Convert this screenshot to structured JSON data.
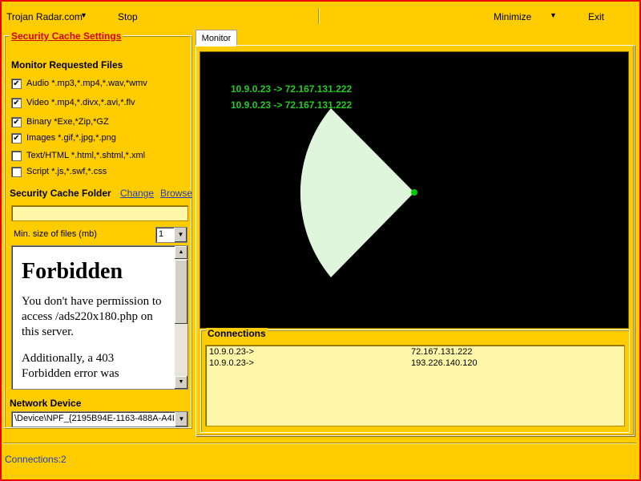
{
  "topbar": {
    "app_title": "Trojan Radar.com",
    "stop_label": "Stop",
    "minimize_label": "Minimize",
    "exit_label": "Exit"
  },
  "settings": {
    "title": "Security Cache Settings",
    "monitor_heading": "Monitor Requested Files",
    "file_types": [
      {
        "label": "Audio *.mp3,*.mp4,*.wav,*wmv",
        "checked": true
      },
      {
        "label": "Video *.mp4,*.divx,*.avi,*.flv",
        "checked": true
      },
      {
        "label": "Binary *Exe,*Zip,*GZ",
        "checked": true
      },
      {
        "label": "Images *.gif,*.jpg,*.png",
        "checked": true
      },
      {
        "label": "Text/HTML *.html,*.shtml,*.xml",
        "checked": false
      },
      {
        "label": "Script *.js,*.swf,*.css",
        "checked": false
      }
    ],
    "folder_heading": "Security Cache Folder",
    "change_link": "Change",
    "browse_link": "Browse",
    "folder_value": "",
    "min_size_label": "Min. size of files (mb)",
    "min_size_value": "1",
    "browser": {
      "heading": "Forbidden",
      "para1": "You don't have permission to access /ads220x180.php on this server.",
      "para2": "Additionally, a 403 Forbidden error was"
    },
    "network_heading": "Network Device",
    "network_value": "\\Device\\NPF_{2195B94E-1163-488A-A4I"
  },
  "monitor": {
    "tab_label": "Monitor",
    "radar_lines": [
      "10.9.0.23 -> 72.167.131.222",
      "10.9.0.23 -> 72.167.131.222"
    ],
    "colors": {
      "radar_text": "#22cc22",
      "sweep": "#dff5dc",
      "dot": "#00cc00"
    }
  },
  "connections": {
    "title": "Connections",
    "rows": [
      {
        "src": "10.9.0.23->",
        "dst": "72.167.131.222"
      },
      {
        "src": "10.9.0.23->",
        "dst": "193.226.140.120"
      }
    ]
  },
  "status": {
    "text": "Connections:2"
  }
}
